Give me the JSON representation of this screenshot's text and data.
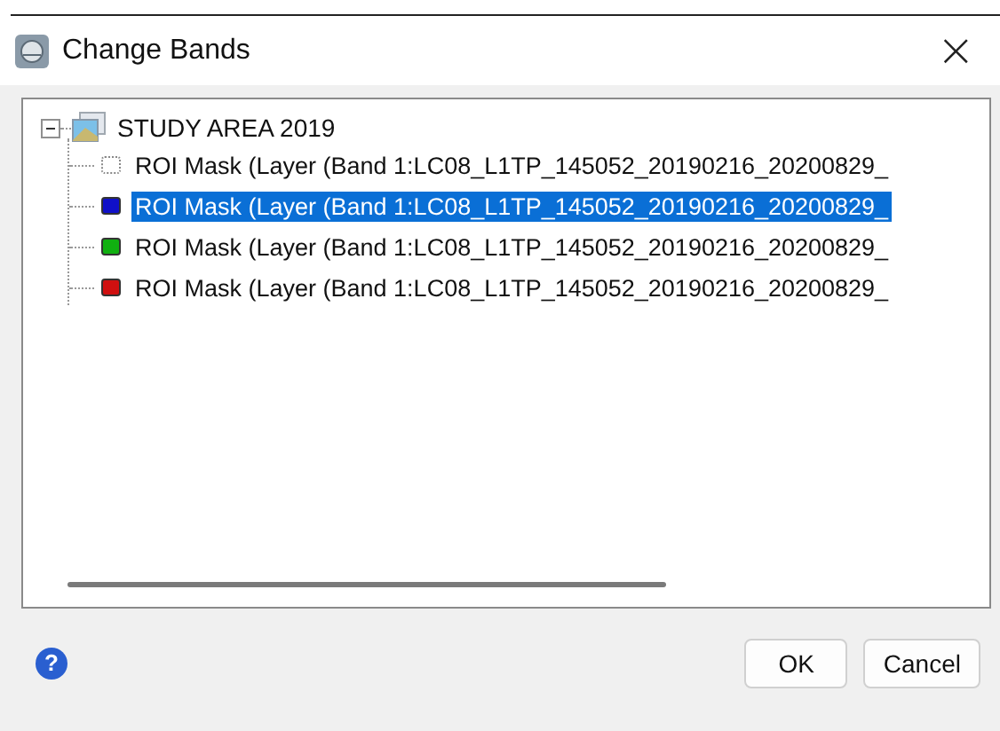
{
  "window": {
    "title": "Change Bands",
    "close": "×"
  },
  "tree": {
    "root": {
      "label": "STUDY AREA 2019",
      "expanded": true,
      "children": [
        {
          "label": "ROI Mask (Layer (Band 1:LC08_L1TP_145052_20190216_20200829_",
          "kind": "empty",
          "selected": false
        },
        {
          "label": "ROI Mask (Layer (Band 1:LC08_L1TP_145052_20190216_20200829_",
          "kind": "color",
          "color": "#1010c8",
          "selected": true
        },
        {
          "label": "ROI Mask (Layer (Band 1:LC08_L1TP_145052_20190216_20200829_",
          "kind": "color",
          "color": "#10b010",
          "selected": false
        },
        {
          "label": "ROI Mask (Layer (Band 1:LC08_L1TP_145052_20190216_20200829_",
          "kind": "color",
          "color": "#d01010",
          "selected": false
        }
      ]
    }
  },
  "help": "?",
  "buttons": [
    "OK",
    "Cancel"
  ]
}
